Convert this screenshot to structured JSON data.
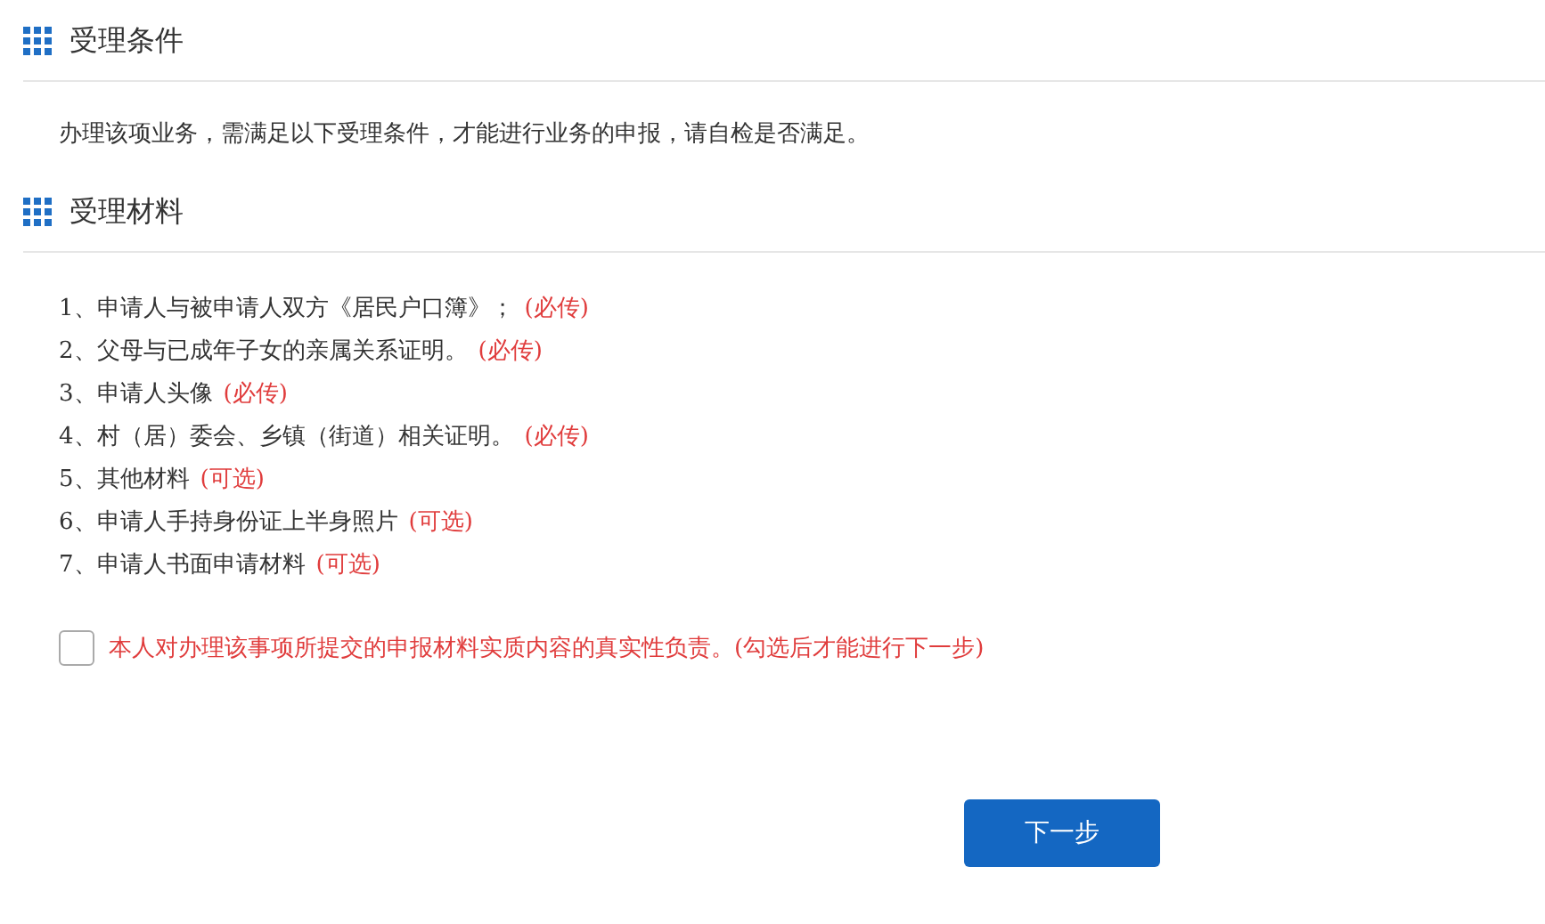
{
  "sections": [
    {
      "title": "受理条件",
      "description": "办理该项业务，需满足以下受理条件，才能进行业务的申报，请自检是否满足。"
    },
    {
      "title": "受理材料",
      "materials": [
        {
          "text": "1、申请人与被申请人双方《居民户口簿》；",
          "tag": "(必传)"
        },
        {
          "text": "2、父母与已成年子女的亲属关系证明。",
          "tag": "(必传)"
        },
        {
          "text": "3、申请人头像",
          "tag": "(必传)"
        },
        {
          "text": "4、村（居）委会、乡镇（街道）相关证明。",
          "tag": "(必传)"
        },
        {
          "text": "5、其他材料",
          "tag": "(可选)"
        },
        {
          "text": "6、申请人手持身份证上半身照片",
          "tag": "(可选)"
        },
        {
          "text": "7、申请人书面申请材料",
          "tag": "(可选)"
        }
      ]
    }
  ],
  "agreement": {
    "checked": false,
    "label": "本人对办理该事项所提交的申报材料实质内容的真实性负责。(勾选后才能进行下一步)"
  },
  "next_button": "下一步"
}
